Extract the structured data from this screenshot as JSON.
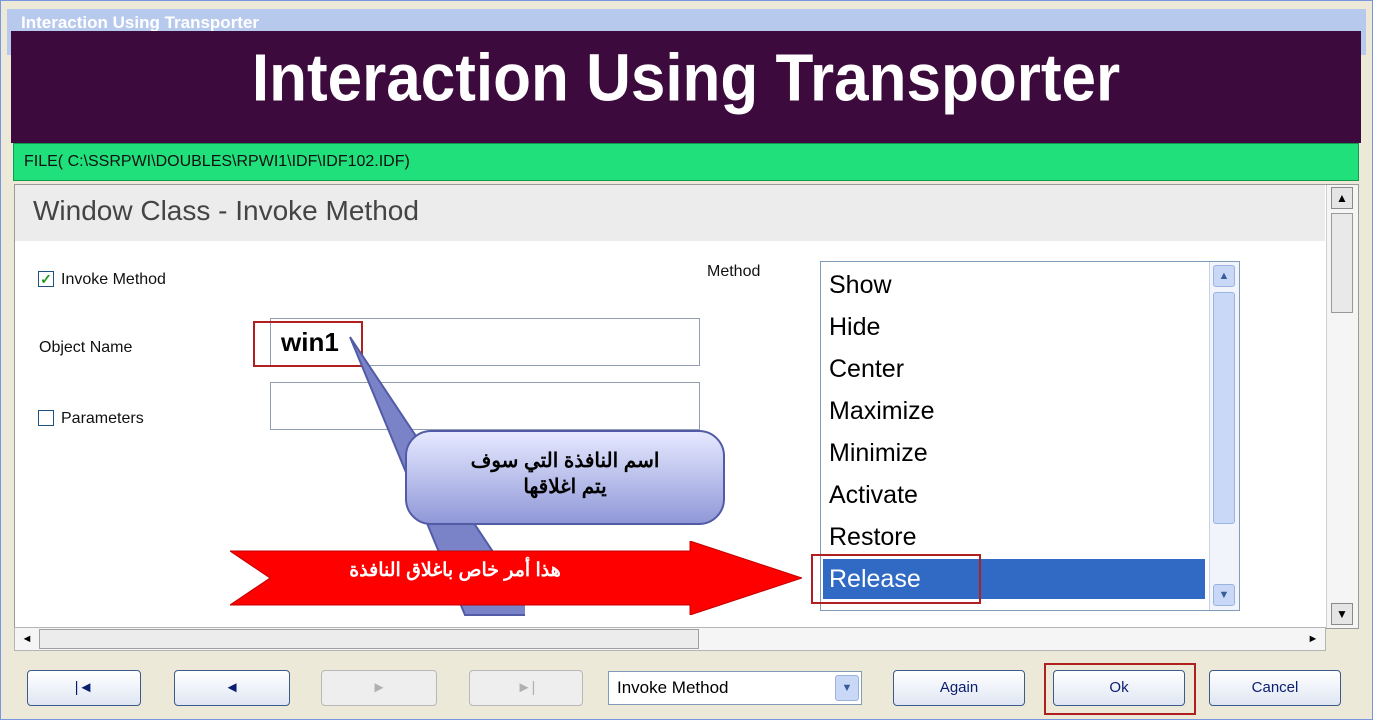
{
  "window": {
    "title": "Interaction Using Transporter",
    "banner": "Interaction Using Transporter",
    "file_path": "FILE( C:\\SSRPWI\\DOUBLES\\RPWI1\\IDF\\IDF102.IDF)"
  },
  "panel": {
    "heading": "Window Class - Invoke Method",
    "invoke_method_label": "Invoke Method",
    "invoke_method_checked": true,
    "object_name_label": "Object Name",
    "object_name_value": "win1",
    "parameters_label": "Parameters",
    "parameters_checked": false,
    "parameters_value": "",
    "method_label": "Method",
    "method_options": [
      "Show",
      "Hide",
      "Center",
      "Maximize",
      "Minimize",
      "Activate",
      "Restore",
      "Release"
    ],
    "method_selected": "Release"
  },
  "annotations": {
    "callout_text_line1": "اسم النافذة التي سوف",
    "callout_text_line2": "يتم اغلاقها",
    "arrow_text": "هذا أمر خاص باغلاق النافذة"
  },
  "toolbar": {
    "first_symbol": "|◄",
    "prev_symbol": "◄",
    "next_symbol": "►",
    "last_symbol": "►|",
    "mode_value": "Invoke Method",
    "again_label": "Again",
    "ok_label": "Ok",
    "cancel_label": "Cancel"
  },
  "colors": {
    "banner_bg": "#3c0a3c",
    "file_bar_bg": "#1fe07a",
    "selection": "#316ac5",
    "highlight_border": "#b02020",
    "arrow_red": "#ff0000"
  }
}
